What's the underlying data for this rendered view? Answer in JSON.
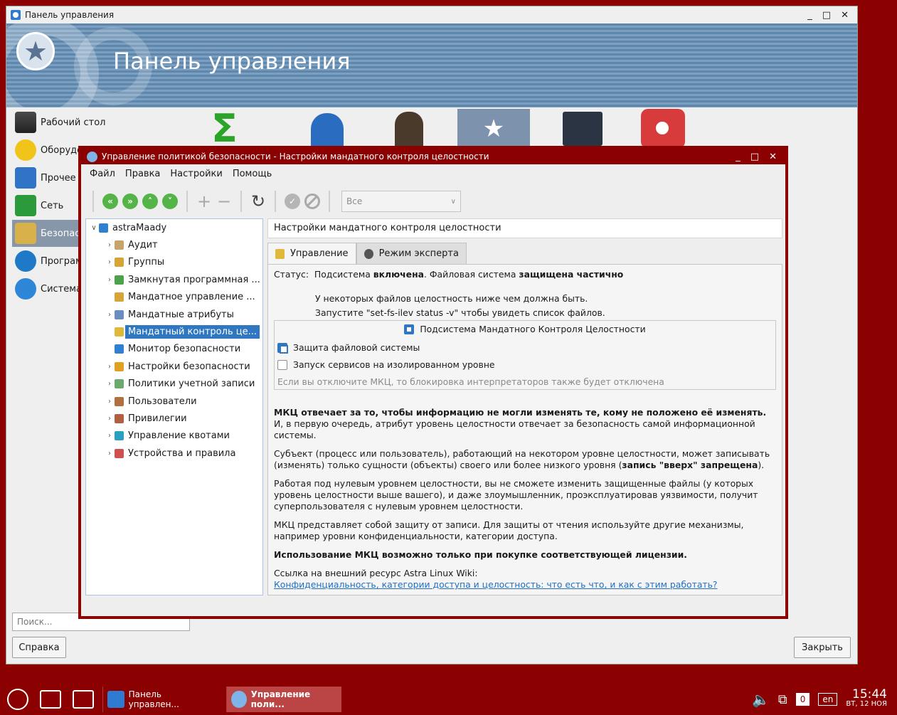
{
  "cp": {
    "title": "Панель управления",
    "banner_title": "Панель управления",
    "sidebar": [
      {
        "label": "Рабочий стол",
        "icon": "desktop-icon"
      },
      {
        "label": "Оборудо",
        "icon": "hardware-icon"
      },
      {
        "label": "Прочее",
        "icon": "misc-icon"
      },
      {
        "label": "Сеть",
        "icon": "network-icon"
      },
      {
        "label": "Безопасн",
        "icon": "security-icon"
      },
      {
        "label": "Програм",
        "icon": "programs-icon"
      },
      {
        "label": "Система",
        "icon": "system-icon"
      }
    ],
    "search_placeholder": "Поиск...",
    "help_button": "Справка",
    "close_button": "Закрыть"
  },
  "dialog": {
    "title": "Управление политикой безопасности - Настройки мандатного контроля целостности",
    "menu": [
      "Файл",
      "Правка",
      "Настройки",
      "Помощь"
    ],
    "filter_value": "Все",
    "tree": {
      "root": "astraMaady",
      "items": [
        {
          "label": "Аудит",
          "expandable": true,
          "color": "#c9a46a"
        },
        {
          "label": "Группы",
          "expandable": true,
          "color": "#d8a337"
        },
        {
          "label": "Замкнутая программная ...",
          "expandable": true,
          "color": "#4aa34a"
        },
        {
          "label": "Мандатное управление ...",
          "expandable": false,
          "color": "#d8a337"
        },
        {
          "label": "Мандатные атрибуты",
          "expandable": true,
          "color": "#6a8dc0"
        },
        {
          "label": "Мандатный контроль це...",
          "expandable": false,
          "color": "#e0b83a",
          "selected": true
        },
        {
          "label": "Монитор безопасности",
          "expandable": false,
          "color": "#2f80d0"
        },
        {
          "label": "Настройки безопасности",
          "expandable": true,
          "color": "#e0a020"
        },
        {
          "label": "Политики учетной записи",
          "expandable": true,
          "color": "#6aaa6a"
        },
        {
          "label": "Пользователи",
          "expandable": true,
          "color": "#b07040"
        },
        {
          "label": "Привилегии",
          "expandable": true,
          "color": "#b06040"
        },
        {
          "label": "Управление квотами",
          "expandable": true,
          "color": "#2aa0c0"
        },
        {
          "label": "Устройства и правила",
          "expandable": true,
          "color": "#d05050"
        }
      ]
    },
    "path": "Настройки мандатного контроля целостности",
    "tabs": [
      "Управление",
      "Режим эксперта"
    ],
    "status_label": "Статус:",
    "status_a": "Подсистема",
    "status_b": "включена",
    "status_c": ".   Файловая система",
    "status_d": "защищена частично",
    "note1": "У некоторых файлов целостность ниже чем должна быть.",
    "note2": "Запустите \"set-fs-ilev status -v\" чтобы увидеть список файлов.",
    "group_title": "Подсистема Мандатного Контроля Целостности",
    "cb_fs": "Защита файловой системы",
    "cb_iso": "Запуск сервисов на изолированном уровне",
    "group_hint": "Если вы отключите МКЦ, то блокировка интерпретаторов также будет отключена",
    "p1_bold": "МКЦ отвечает за то, чтобы информацию не могли изменять те, кому не положено её изменять.",
    "p1_rest": " И, в первую очередь, атрибут уровень целостности отвечает за безопасность самой информационной системы.",
    "p2_a": "Субъект (процесс или пользователь), работающий на некотором уровне целостности, может записывать (изменять) только сущности (объекты) своего или более низкого уровня (",
    "p2_bold": "запись \"вверх\" запрещена",
    "p2_c": ").",
    "p3": "Работая под нулевым уровнем целостности, вы не сможете изменить защищенные файлы (у которых уровень целостности выше вашего), и даже злоумышленник, проэксплуатировав уязвимости, получит суперпользователя с нулевым уровнем целостности.",
    "p4": "МКЦ представляет собой защиту от записи. Для защиты от чтения используйте другие механизмы, например уровни конфиденциальности, категории доступа.",
    "p5_bold": "Использование МКЦ возможно только при покупке соответствующей лицензии.",
    "link_label": "Ссылка на внешний ресурс Astra Linux Wiki:",
    "link_text": "Конфиденциальность, категории доступа и целостность: что есть что, и как с этим работать?"
  },
  "taskbar": {
    "task1": "Панель управлен...",
    "task2": "Управление поли...",
    "lang": "en",
    "counter": "0",
    "time": "15:44",
    "date": "ВТ, 12 НОЯ"
  },
  "colors": {
    "accent": "#8b0000",
    "selection": "#2f77c0",
    "link": "#1f6fc5"
  }
}
